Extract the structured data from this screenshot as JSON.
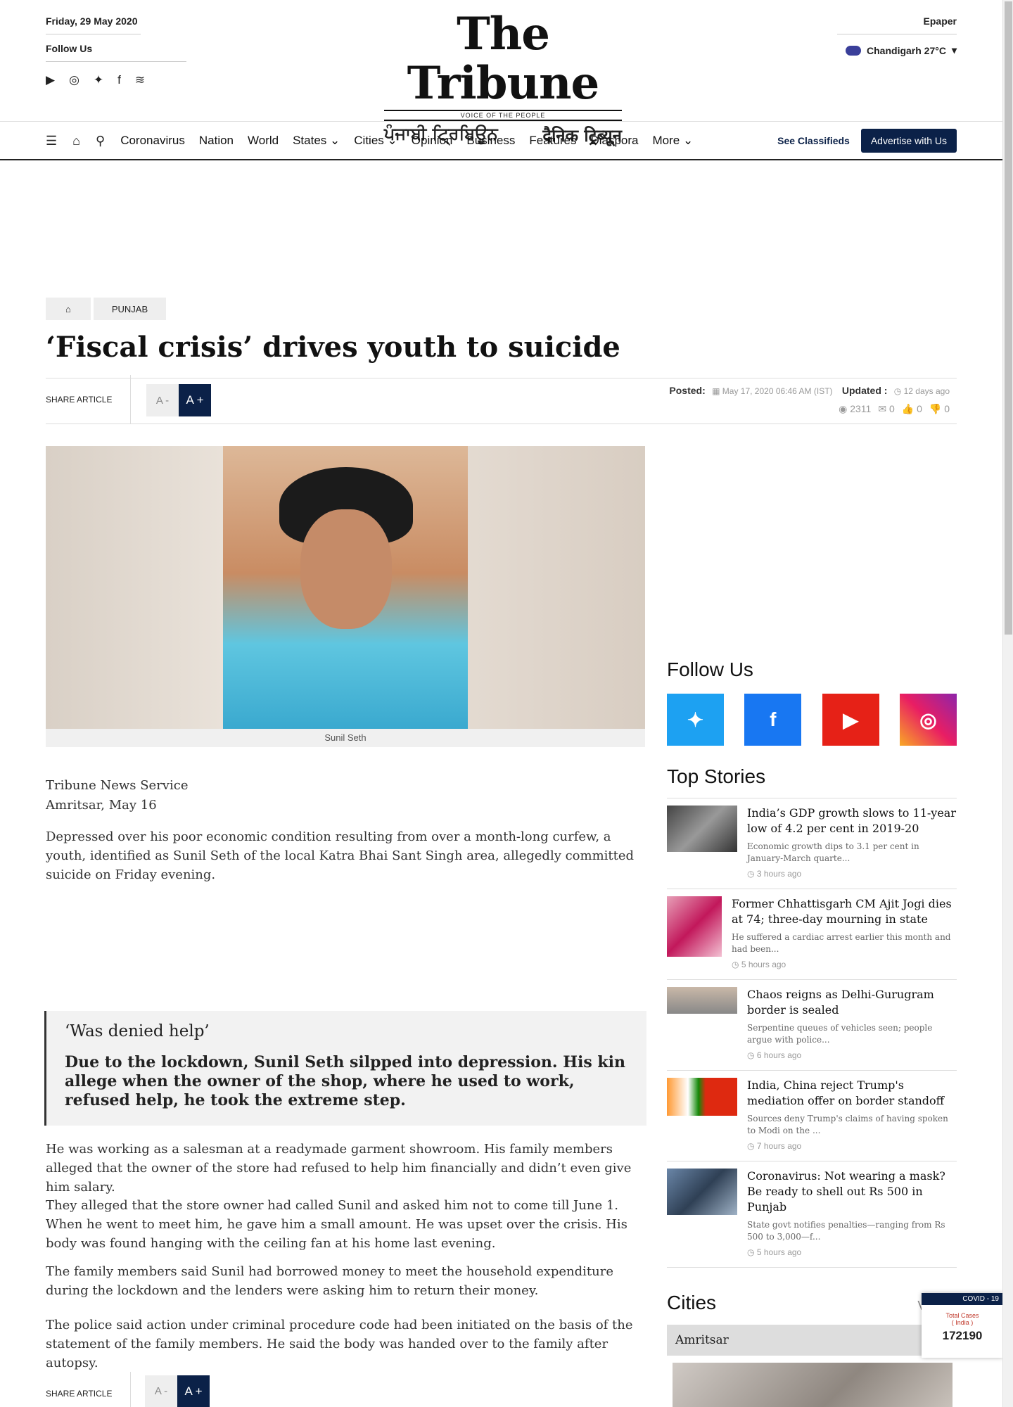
{
  "header": {
    "date": "Friday, 29 May 2020",
    "follow_us": "Follow Us",
    "logo_main": "The Tribune",
    "logo_tagline": "VOICE OF THE PEOPLE",
    "logo_punjabi": "ਪੰਜਾਬੀ ਟ੍ਰਿਬਿਊਨ",
    "logo_hindi": "दैनिक ट्रिब्यून",
    "epaper": "Epaper",
    "weather": "Chandigarh 27°C"
  },
  "nav": {
    "items": [
      "Coronavirus",
      "Nation",
      "World",
      "States",
      "Cities",
      "Opinion",
      "Business",
      "Features",
      "Diaspora",
      "More"
    ],
    "classifieds": "See Classifieds",
    "advertise": "Advertise with Us"
  },
  "breadcrumb": {
    "section": "PUNJAB"
  },
  "article": {
    "title": "‘Fiscal crisis’ drives youth to suicide",
    "share_label": "SHARE ARTICLE",
    "font_minus": "A -",
    "font_plus": "A +",
    "posted_label": "Posted:",
    "posted_date": "May 17, 2020 06:46 AM (IST)",
    "updated_label": "Updated :",
    "updated_ago": "12 days ago",
    "views": "2311",
    "comments": "0",
    "likes": "0",
    "dislikes": "0",
    "caption": "Sunil Seth",
    "source": "Tribune News Service",
    "dateline": "Amritsar, May 16",
    "p1": "Depressed over his poor economic condition resulting from over a month-long curfew, a youth, identified as Sunil Seth of the local Katra Bhai Sant Singh area, allegedly committed suicide on Friday evening.",
    "quote_heading": "‘Was denied help’",
    "quote_text": "Due to the lockdown, Sunil Seth silpped into depression. His kin allege when the owner of the shop, where he used to work, refused help, he took the extreme step.",
    "p2": "He was working as a salesman at a readymade garment showroom. His family members alleged that the owner of the store had refused to help him financially and didn’t even give him salary.",
    "p3": "They alleged that the store owner had called Sunil and asked him not to come till June 1. When he went to meet him, he gave him a small amount. He was upset over the crisis. His body was found hanging with the ceiling fan at his home last evening.",
    "p4": "The family members said Sunil had borrowed money to meet the household expenditure during the lockdown and the lenders were asking him to return their money.",
    "p5": "The police said action under criminal procedure code had been initiated on the basis of the statement of the family members. He said the body was handed over to the family after autopsy."
  },
  "sidebar": {
    "follow_heading": "Follow Us",
    "top_stories_heading": "Top Stories",
    "stories": [
      {
        "title": "India’s GDP growth slows to 11-year low of 4.2 per cent in 2019-20",
        "summary": "Economic growth dips to 3.1 per cent in January-March quarte...",
        "time": "3 hours ago"
      },
      {
        "title": "Former Chhattisgarh CM Ajit Jogi dies at 74; three-day mourning in state",
        "summary": "He suffered a cardiac arrest earlier this month and had been...",
        "time": "5 hours ago"
      },
      {
        "title": "Chaos reigns as Delhi-Gurugram border is sealed",
        "summary": "Serpentine queues of vehicles seen; people argue with police...",
        "time": "6 hours ago"
      },
      {
        "title": "India, China reject Trump's mediation offer on border standoff",
        "summary": "Sources deny Trump's claims of having spoken to Modi on the ...",
        "time": "7 hours ago"
      },
      {
        "title": "Coronavirus: Not wearing a mask? Be ready to shell out Rs 500 in Punjab",
        "summary": "State govt notifies penalties—ranging from Rs 500 to 3,000—f...",
        "time": "5 hours ago"
      }
    ],
    "cities_heading": "Cities",
    "view_all": "Vi",
    "city_selected": "Amritsar"
  },
  "covid": {
    "label": "COVID - 19",
    "total_label": "Total Cases",
    "region": "( India )",
    "total": "172190"
  }
}
